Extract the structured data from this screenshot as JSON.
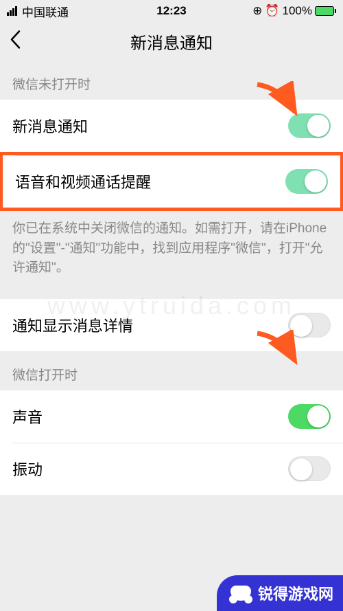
{
  "statusbar": {
    "carrier": "中国联通",
    "time": "12:23",
    "battery_pct": "100%"
  },
  "nav": {
    "title": "新消息通知"
  },
  "sections": {
    "closed": {
      "header": "微信未打开时",
      "rows": {
        "new_msg": {
          "label": "新消息通知",
          "on": true
        },
        "voice_video": {
          "label": "语音和视频通话提醒",
          "on": true
        }
      },
      "footer": "你已在系统中关闭微信的通知。如需打开，请在iPhone的\"设置\"-\"通知\"功能中，找到应用程序\"微信\"，打开\"允许通知\"。"
    },
    "detail": {
      "rows": {
        "show_detail": {
          "label": "通知显示消息详情",
          "on": false
        }
      }
    },
    "open": {
      "header": "微信打开时",
      "rows": {
        "sound": {
          "label": "声音",
          "on": true
        },
        "vibrate": {
          "label": "振动",
          "on": false
        }
      }
    }
  },
  "watermark": "www.ytruida.com",
  "badge": "锐得游戏网"
}
